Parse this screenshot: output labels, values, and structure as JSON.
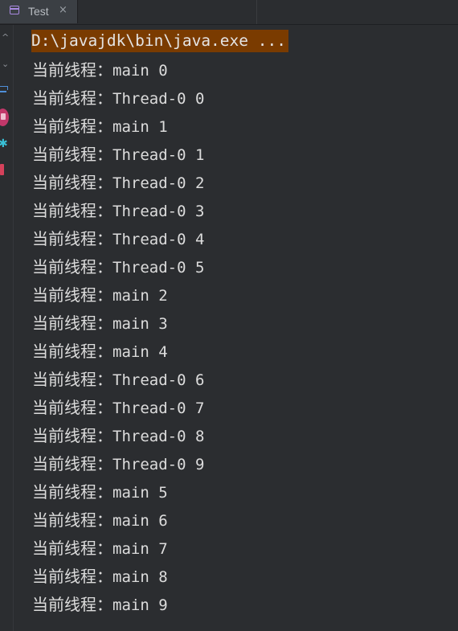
{
  "tab": {
    "title": "Test",
    "close_glyph": "×",
    "icon": "console-window-icon"
  },
  "gutter": {
    "icons": [
      "scroll-up-icon",
      "scroll-down-icon",
      "soft-wrap-icon",
      "print-icon",
      "settings-icon",
      "trash-icon"
    ],
    "up_glyph": "^",
    "down_glyph": "⌄",
    "gear_glyph": "✱"
  },
  "console": {
    "command": "D:\\javajdk\\bin\\java.exe ...",
    "prefix": "当前线程：",
    "lines": [
      {
        "thread": "main",
        "n": "0"
      },
      {
        "thread": "Thread-0",
        "n": "0"
      },
      {
        "thread": "main",
        "n": "1"
      },
      {
        "thread": "Thread-0",
        "n": "1"
      },
      {
        "thread": "Thread-0",
        "n": "2"
      },
      {
        "thread": "Thread-0",
        "n": "3"
      },
      {
        "thread": "Thread-0",
        "n": "4"
      },
      {
        "thread": "Thread-0",
        "n": "5"
      },
      {
        "thread": "main",
        "n": "2"
      },
      {
        "thread": "main",
        "n": "3"
      },
      {
        "thread": "main",
        "n": "4"
      },
      {
        "thread": "Thread-0",
        "n": "6"
      },
      {
        "thread": "Thread-0",
        "n": "7"
      },
      {
        "thread": "Thread-0",
        "n": "8"
      },
      {
        "thread": "Thread-0",
        "n": "9"
      },
      {
        "thread": "main",
        "n": "5"
      },
      {
        "thread": "main",
        "n": "6"
      },
      {
        "thread": "main",
        "n": "7"
      },
      {
        "thread": "main",
        "n": "8"
      },
      {
        "thread": "main",
        "n": "9"
      }
    ]
  },
  "colors": {
    "background": "#2b2d30",
    "command_highlight": "#7a3b00",
    "text": "#dcdcdc",
    "tab_active": "#3b3f44"
  }
}
